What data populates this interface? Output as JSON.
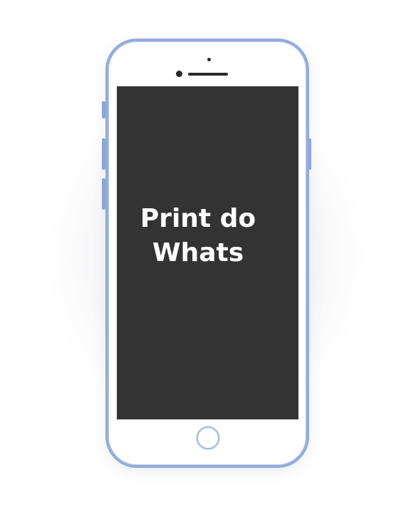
{
  "screen": {
    "text": "Print do\nWhats",
    "background": "#333333",
    "text_color": "#ffffff"
  },
  "phone": {
    "frame_color": "#94acdc",
    "body_color": "#ffffff"
  }
}
